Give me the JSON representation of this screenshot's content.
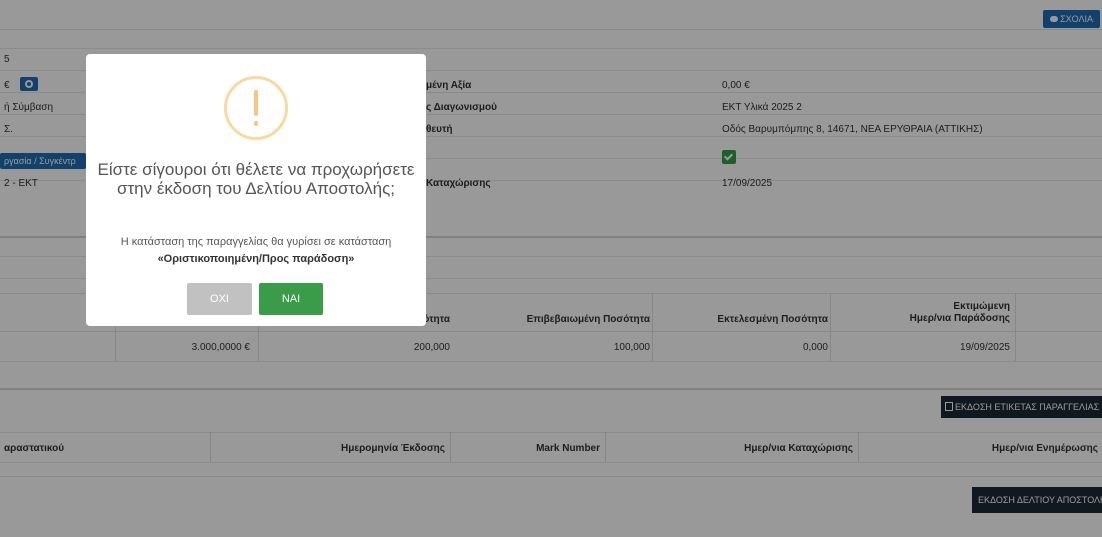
{
  "header": {
    "comments_label": "ΣΧΟΛΙΑ"
  },
  "info": {
    "left": {
      "row1": "5",
      "row2": "€",
      "row3": "ή Σύμβαση",
      "row4": "Σ.",
      "status": "ργασία / Συγκέντρ",
      "row6": "2 - ΕΚΤ"
    },
    "right": {
      "labels": [
        "μένη Αξία",
        "ς Διαγωνισμού",
        "θευτή",
        "",
        "Καταχώρισης"
      ],
      "values": [
        "0,00 €",
        "ΕΚΤ Υλικά 2025 2",
        "Οδός Βαρυμπόμπης  8,  14671, ΝΕΑ ΕΡΥΘΡΑΙΑ (ΑΤΤΙΚΗΣ)",
        "",
        "17/09/2025"
      ]
    }
  },
  "products": {
    "headers": {
      "qty": "ότητα",
      "confirmed": "Επιβεβαιωμένη Ποσότητα",
      "executed": "Εκτελεσμένη Ποσότητα",
      "est_date_line1": "Εκτιμώμενη",
      "est_date_line2": "Ημερ/νια Παράδοσης"
    },
    "row": {
      "amount": "3.000,0000 €",
      "qty": "200,000",
      "confirmed": "100,000",
      "executed": "0,000",
      "est_date": "19/09/2025"
    }
  },
  "documents": {
    "label_button": "ΕΚΔΟΣΗ ΕΤΙΚΕΤΑΣ ΠΑΡΑΓΓΕΛΙΑΣ",
    "headers": {
      "doc": "αραστατικού",
      "issue_date": "Ημερομηνία Έκδοσης",
      "mark": "Mark Number",
      "reg_date": "Ημερ/νια Καταχώρισης",
      "update_date": "Ημερ/νια Ενημέρωσης"
    },
    "issue_button": "ΕΚΔΟΣΗ ΔΕΛΤΙΟΥ ΑΠΟΣΤΟΛΗΣ"
  },
  "modal": {
    "title": "Είστε σίγουροι ότι θέλετε να προχωρήσετε στην έκδοση του Δελτίου Αποστολής;",
    "text": "Η κατάσταση της παραγγελίας θα γυρίσει σε κατάσταση",
    "text_bold": "«Οριστικοποιημένη/Προς παράδοση»",
    "no_label": "ΟΧΙ",
    "yes_label": "ΝΑΙ"
  },
  "colors": {
    "primary": "#1f6fb5",
    "success": "#3a9b48",
    "warning": "#f5c684",
    "dark": "#1d2b36",
    "muted": "#c1c1c1"
  }
}
